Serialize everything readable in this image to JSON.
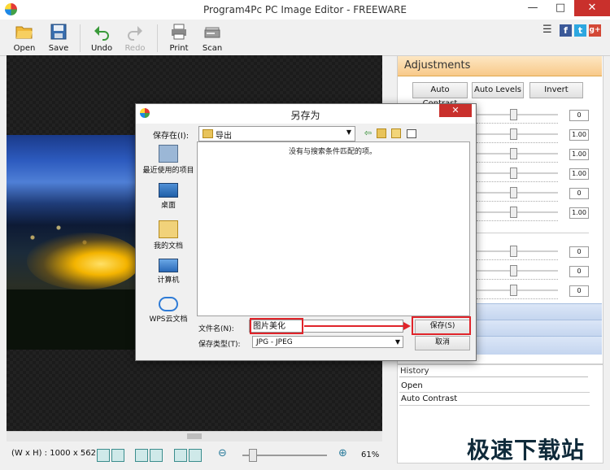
{
  "window": {
    "title": "Program4Pc PC Image Editor - FREEWARE",
    "controls": [
      "—",
      "□",
      "✕"
    ]
  },
  "toolbar": {
    "open": "Open",
    "save": "Save",
    "undo": "Undo",
    "redo": "Redo",
    "print": "Print",
    "scan": "Scan"
  },
  "social": {
    "menu": "☰",
    "facebook": "f",
    "twitter": "t",
    "googleplus": "g+"
  },
  "status": {
    "dimensions": "(W x H) : 1000 x 562",
    "zoom": "61%",
    "zoom_value": 0.08
  },
  "adjustments": {
    "title": "Adjustments",
    "buttons": [
      "Auto Contrast",
      "Auto Levels",
      "Invert"
    ],
    "values_top": [
      "0",
      "1.00",
      "1.00",
      "1.00",
      "0",
      "1.00"
    ],
    "values_bottom": [
      "0",
      "0",
      "0"
    ]
  },
  "history": {
    "title": "History",
    "items": [
      "Open",
      "Auto Contrast"
    ]
  },
  "dialog": {
    "title": "另存为",
    "save_in_label": "保存在(I):",
    "save_in_value": "导出",
    "empty_message": "没有与搜索条件匹配的项。",
    "places": [
      "最近使用的项目",
      "桌面",
      "我的文档",
      "计算机",
      "WPS云文档"
    ],
    "filename_label": "文件名(N):",
    "filename_value": "图片美化",
    "filetype_label": "保存类型(T):",
    "filetype_value": "JPG - JPEG",
    "save_button": "保存(S)",
    "cancel_button": "取消",
    "close": "✕"
  },
  "watermark": "极速下载站",
  "colors": {
    "accent_orange": "#f8c989",
    "highlight_red": "#e0242a",
    "close_red": "#c9302c",
    "panel_blue": "#c4d5ef"
  }
}
